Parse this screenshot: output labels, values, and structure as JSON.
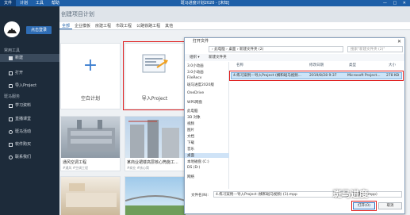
{
  "titlebar": {
    "app_title": "斑马进度计划2020 - [未知]",
    "menu": [
      "文件",
      "计划",
      "工具",
      "帮助"
    ],
    "controls": "— □ ✕"
  },
  "sidebar": {
    "login_label": "点击登录",
    "section_common": "常用工具",
    "section_learn": "斑马服务",
    "items": [
      {
        "label": "新建",
        "icon": "new-icon"
      },
      {
        "label": "打开",
        "icon": "folder-icon"
      },
      {
        "label": "导入Project",
        "icon": "import-icon"
      },
      {
        "label": "学习资料",
        "icon": "book-icon"
      },
      {
        "label": "直播课堂",
        "icon": "video-icon"
      },
      {
        "label": "斑马活动",
        "icon": "activity-icon"
      },
      {
        "label": "软件购买",
        "icon": "cart-icon"
      },
      {
        "label": "联系我们",
        "icon": "contact-icon"
      }
    ]
  },
  "main": {
    "page_title": "创建项目计划",
    "tabs": [
      "全部",
      "企业模板",
      "房建工程",
      "市政工程",
      "公路铁路工程",
      "其他"
    ],
    "blank_plan_label": "空白计划",
    "import_label": "导入Project",
    "templates": [
      {
        "name": "通风空调工程",
        "tags": "#通风 #空调工程"
      },
      {
        "name": "某商业裙楼高层核心筒施工...",
        "tags": "#商业 #核心筒"
      },
      {
        "name": "",
        "tags": ""
      },
      {
        "name": "",
        "tags": ""
      }
    ]
  },
  "dialog": {
    "title": "打开文件",
    "close": "✕",
    "address": "› 此电脑 › 桌面 › 新建文件夹 (2)",
    "search_placeholder": "搜索\"新建文件夹 (2)\"",
    "toolbar": [
      "组织 ▾",
      "新建文件夹"
    ],
    "nav": [
      "3.0小动画",
      "3.0小动画",
      "FileRecv",
      "斑马进度2020版",
      "OneDrive",
      "WPS网盘",
      "此电脑",
      "3D 对象",
      "视频",
      "图片",
      "文档",
      "下载",
      "音乐",
      "桌面",
      "本地磁盘 (C:)",
      "DS (D:)",
      "网络"
    ],
    "selected_nav": 13,
    "columns": [
      "名称",
      "修改日期",
      "类型",
      "大小"
    ],
    "file": {
      "name": "4.练习案例---导入Project (横和斑马视频...",
      "date": "2019/8/28 9:37",
      "type": "Microsoft Project...",
      "size": "278 KB"
    },
    "filename_label": "文件名(N):",
    "filename_value": "4.练习案例---导入Project (横和斑马视频) (1).mpp",
    "filetype_value": "项目 (*.mpp)",
    "open_label": "打开(O)",
    "cancel_label": "取消"
  },
  "watermark": "斑马进度"
}
